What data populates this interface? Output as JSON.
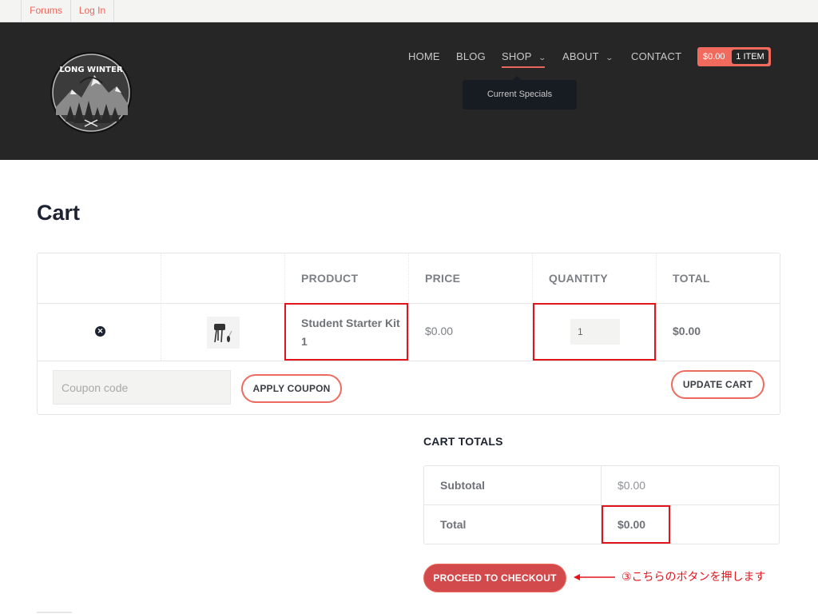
{
  "topbar": {
    "links": [
      "Forums",
      "Log In"
    ]
  },
  "header": {
    "logo_text": "LONG WINTER",
    "nav": [
      {
        "label": "HOME",
        "has_dropdown": false
      },
      {
        "label": "BLOG",
        "has_dropdown": false
      },
      {
        "label": "SHOP",
        "has_dropdown": true,
        "active": true
      },
      {
        "label": "ABOUT",
        "has_dropdown": true
      },
      {
        "label": "CONTACT",
        "has_dropdown": false
      }
    ],
    "dropdown_item": "Current Specials",
    "cart": {
      "price": "$0.00",
      "items": "1 ITEM"
    },
    "accent_color": "#f06a5e"
  },
  "page": {
    "title": "Cart"
  },
  "cart_table": {
    "headers": [
      "",
      "",
      "PRODUCT",
      "PRICE",
      "QUANTITY",
      "TOTAL"
    ],
    "rows": [
      {
        "remove_icon": "remove-circle-x",
        "product": "Student Starter Kit 1",
        "price": "$0.00",
        "quantity": "1",
        "total": "$0.00"
      }
    ],
    "coupon_placeholder": "Coupon code",
    "apply_coupon_label": "APPLY COUPON",
    "update_cart_label": "UPDATE CART"
  },
  "cart_totals": {
    "title": "CART TOTALS",
    "subtotal_label": "Subtotal",
    "subtotal_value": "$0.00",
    "total_label": "Total",
    "total_value": "$0.00",
    "checkout_label": "PROCEED TO CHECKOUT"
  },
  "annotation": {
    "text": "③こちらのボタンを押します",
    "color": "#e2141b"
  }
}
